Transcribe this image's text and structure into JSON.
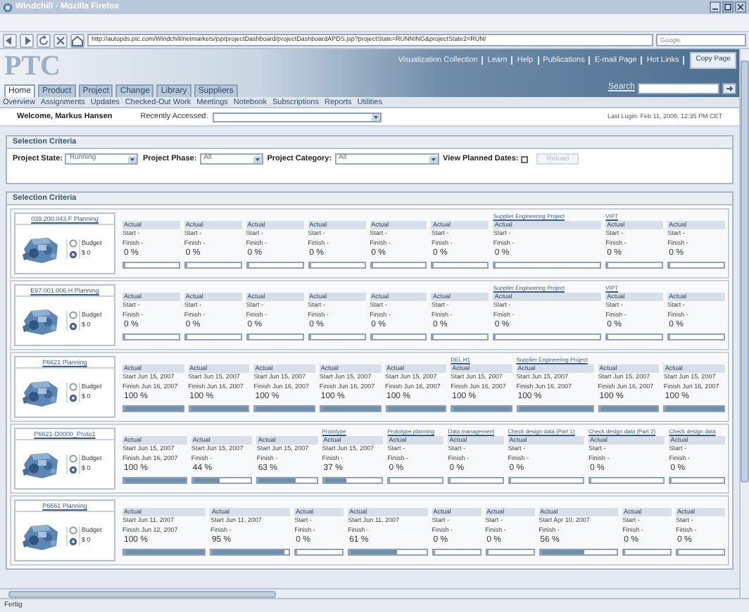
{
  "window": {
    "title": "Windchill - Mozilla Firefox"
  },
  "browser": {
    "url": "http://autopds.ptc.com/Windchill/netmarkets/jsp/projectDashboard/projectDashboardAPDS.jsp?projectState=RUNNING&projectState2=RUNI",
    "search_placeholder": "Google",
    "status": "Fertig"
  },
  "header": {
    "logo": "PTC",
    "links": [
      "Visualization Collection",
      "Learn",
      "Help",
      "Publications",
      "E-mail Page",
      "Hot Links"
    ],
    "copy_button": "Copy Page",
    "search_label": "Search",
    "tabs": [
      {
        "label": "Home",
        "selected": true
      },
      {
        "label": "Product",
        "selected": false
      },
      {
        "label": "Project",
        "selected": false
      },
      {
        "label": "Change",
        "selected": false
      },
      {
        "label": "Library",
        "selected": false
      },
      {
        "label": "Suppliers",
        "selected": false
      }
    ]
  },
  "subnav": [
    "Overview",
    "Assignments",
    "Updates",
    "Checked-Out Work",
    "Meetings",
    "Notebook",
    "Subscriptions",
    "Reports",
    "Utilities"
  ],
  "welcome": "Welcome, Markus Hansen",
  "recently_accessed_label": "Recently Accessed:",
  "last_login": "Last Login: Feb 11, 2006, 12:35 PM CET",
  "criteria": {
    "title": "Selection Criteria",
    "fields": [
      {
        "label": "Project State:",
        "value": "Running"
      },
      {
        "label": "Project Phase:",
        "value": "All"
      },
      {
        "label": "Project Category:",
        "value": "All"
      }
    ],
    "view_planned_dates": {
      "label": "View Planned Dates:",
      "checked": false
    },
    "reload_button": {
      "label": "Reload",
      "disabled": true
    }
  },
  "projects_panel": {
    "title": "Selection Criteria",
    "projects": [
      {
        "name": "039.200.043.F Planning",
        "budget_label": "Budget",
        "budget": "$ 0",
        "milestones": [
          {
            "status": "Actual",
            "start": "Start -",
            "finish": "Finish -",
            "percent": "0 %",
            "level": 0
          },
          {
            "status": "Actual",
            "start": "Start -",
            "finish": "Finish -",
            "percent": "0 %",
            "level": 0
          },
          {
            "status": "Actual",
            "start": "Start -",
            "finish": "Finish -",
            "percent": "0 %",
            "level": 0
          },
          {
            "status": "Actual",
            "start": "Start -",
            "finish": "Finish -",
            "percent": "0 %",
            "level": 0
          },
          {
            "status": "Actual",
            "start": "Start -",
            "finish": "Finish -",
            "percent": "0 %",
            "level": 0
          },
          {
            "status": "Actual",
            "start": "Start -",
            "finish": "Finish -",
            "percent": "0 %",
            "level": 0
          },
          {
            "label": "Supplier Engineering Project",
            "status": "Actual",
            "start": "Start -",
            "finish": "Finish -",
            "percent": "0 %",
            "level": 0
          },
          {
            "label": "VIPT",
            "status": "Actual",
            "start": "Start -",
            "finish": "Finish -",
            "percent": "0 %",
            "level": 0
          },
          {
            "status": "Actual",
            "start": "Start -",
            "finish": "Finish -",
            "percent": "0 %",
            "level": 0
          }
        ]
      },
      {
        "name": "E97.001.006.H Planning",
        "budget_label": "Budget",
        "budget": "$ 0",
        "milestones": [
          {
            "status": "Actual",
            "start": "Start -",
            "finish": "Finish -",
            "percent": "0 %",
            "level": 0
          },
          {
            "status": "Actual",
            "start": "Start -",
            "finish": "Finish -",
            "percent": "0 %",
            "level": 0
          },
          {
            "status": "Actual",
            "start": "Start -",
            "finish": "Finish -",
            "percent": "0 %",
            "level": 0
          },
          {
            "status": "Actual",
            "start": "Start -",
            "finish": "Finish -",
            "percent": "0 %",
            "level": 0
          },
          {
            "status": "Actual",
            "start": "Start -",
            "finish": "Finish -",
            "percent": "0 %",
            "level": 0
          },
          {
            "status": "Actual",
            "start": "Start -",
            "finish": "Finish -",
            "percent": "0 %",
            "level": 0
          },
          {
            "label": "Supplier Engineering Project",
            "status": "Actual",
            "start": "Start -",
            "finish": "Finish -",
            "percent": "0 %",
            "level": 0
          },
          {
            "label": "VIPT",
            "status": "Actual",
            "start": "Start -",
            "finish": "Finish -",
            "percent": "0 %",
            "level": 0
          },
          {
            "status": "Actual",
            "start": "Start -",
            "finish": "Finish -",
            "percent": "0 %",
            "level": 0
          }
        ]
      },
      {
        "name": "P6621 Planning",
        "budget_label": "Budget",
        "budget": "$ 0",
        "milestones": [
          {
            "status": "Actual",
            "start": "Start Jun 15, 2007",
            "finish": "Finish Jun 16, 2007",
            "percent": "100 %",
            "level": 1
          },
          {
            "status": "Actual",
            "start": "Start Jun 15, 2007",
            "finish": "Finish Jun 16, 2007",
            "percent": "100 %",
            "level": 1
          },
          {
            "status": "Actual",
            "start": "Start Jun 15, 2007",
            "finish": "Finish Jun 16, 2007",
            "percent": "100 %",
            "level": 1
          },
          {
            "status": "Actual",
            "start": "Start Jun 15, 2007",
            "finish": "Finish Jun 16, 2007",
            "percent": "100 %",
            "level": 1
          },
          {
            "status": "Actual",
            "start": "Start Jun 15, 2007",
            "finish": "Finish Jun 16, 2007",
            "percent": "100 %",
            "level": 1
          },
          {
            "label": "DEL H1",
            "status": "Actual",
            "start": "Start Jun 15, 2007",
            "finish": "Finish Jun 16, 2007",
            "percent": "100 %",
            "level": 1
          },
          {
            "label": "Supplier Engineering Project",
            "status": "Actual",
            "start": "Start Jun 15, 2007",
            "finish": "Finish Jun 16, 2007",
            "percent": "100 %",
            "level": 1
          },
          {
            "status": "Actual",
            "start": "Start Jun 15, 2007",
            "finish": "Finish Jun 16, 2007",
            "percent": "100 %",
            "level": 1
          },
          {
            "status": "Actual",
            "start": "Start Jun 15, 2007",
            "finish": "Finish Jun 16, 2007",
            "percent": "100 %",
            "level": 1
          }
        ]
      },
      {
        "name": "P6621-D0000_Proto1",
        "budget_label": "Budget",
        "budget": "$ 0",
        "milestones": [
          {
            "status": "Actual",
            "start": "Start Jun 15, 2007",
            "finish": "Finish Jun 16, 2007",
            "percent": "100 %",
            "level": 1
          },
          {
            "status": "Actual",
            "start": "Start Jun 15, 2007",
            "finish": "Finish -",
            "percent": "44 %",
            "level": 0.44
          },
          {
            "status": "Actual",
            "start": "Start Jun 15, 2007",
            "finish": "Finish -",
            "percent": "63 %",
            "level": 0.63
          },
          {
            "label": "Prototype",
            "status": "Actual",
            "start": "Start Jun 15, 2007",
            "finish": "Finish -",
            "percent": "37 %",
            "level": 0.37
          },
          {
            "label": "Prototype planning",
            "status": "Actual",
            "start": "Start -",
            "finish": "Finish -",
            "percent": "0 %",
            "level": 0
          },
          {
            "label": "Data management",
            "status": "Actual",
            "start": "Start -",
            "finish": "Finish -",
            "percent": "0 %",
            "level": 0
          },
          {
            "label": "Check design data (Part 1)",
            "status": "Actual",
            "start": "Start -",
            "finish": "Finish -",
            "percent": "0 %",
            "level": 0
          },
          {
            "label": "Check design data (Part 2)",
            "status": "Actual",
            "start": "Start -",
            "finish": "Finish -",
            "percent": "0 %",
            "level": 0
          },
          {
            "label": "Check design data",
            "status": "Actual",
            "start": "Start -",
            "finish": "Finish -",
            "percent": "0 %",
            "level": 0
          }
        ]
      },
      {
        "name": "P6661 Planning",
        "budget_label": "Budget",
        "budget": "$ 0",
        "milestones": [
          {
            "status": "Actual",
            "start": "Start Jun 11, 2007",
            "finish": "Finish Jun 12, 2007",
            "percent": "100 %",
            "level": 1
          },
          {
            "status": "Actual",
            "start": "Start Jun 11, 2007",
            "finish": "Finish -",
            "percent": "95 %",
            "level": 0.95
          },
          {
            "status": "Actual",
            "start": "Start -",
            "finish": "Finish -",
            "percent": "0 %",
            "level": 0
          },
          {
            "status": "Actual",
            "start": "Start Jun 11, 2007",
            "finish": "Finish -",
            "percent": "61 %",
            "level": 0.61
          },
          {
            "status": "Actual",
            "start": "Start -",
            "finish": "Finish -",
            "percent": "0 %",
            "level": 0
          },
          {
            "status": "Actual",
            "start": "Start -",
            "finish": "Finish -",
            "percent": "0 %",
            "level": 0
          },
          {
            "status": "Actual",
            "start": "Start Apr 10, 2007",
            "finish": "Finish -",
            "percent": "56 %",
            "level": 0.56
          },
          {
            "status": "Actual",
            "start": "Start -",
            "finish": "Finish -",
            "percent": "0 %",
            "level": 0
          },
          {
            "status": "Actual",
            "start": "Start -",
            "finish": "Finish -",
            "percent": "0 %",
            "level": 0
          }
        ]
      }
    ]
  }
}
